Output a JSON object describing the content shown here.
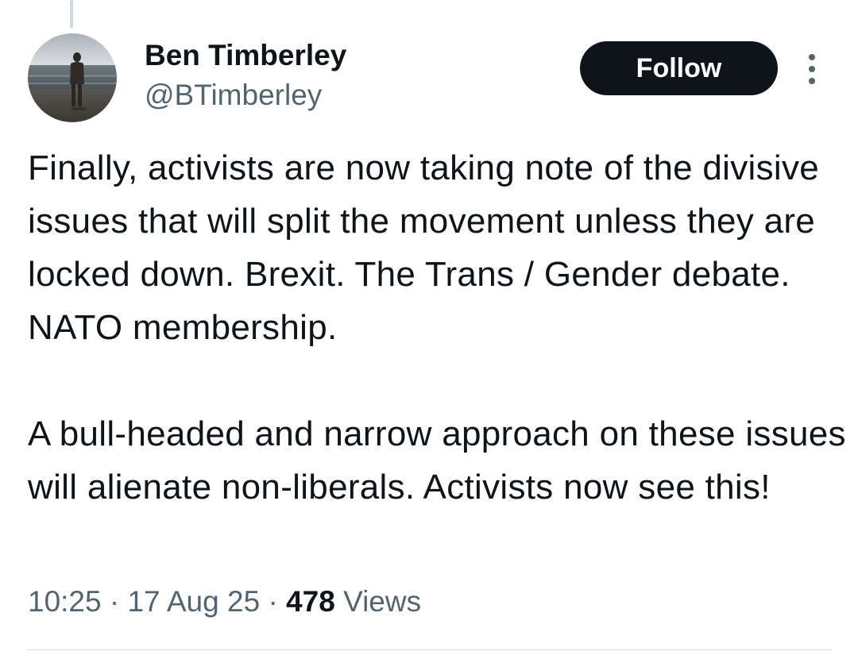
{
  "author": {
    "name": "Ben Timberley",
    "handle": "@BTimberley",
    "avatar_icon": "profile-photo-person-on-beach"
  },
  "actions": {
    "follow_label": "Follow",
    "more_icon": "vertical-ellipsis-icon"
  },
  "tweet": {
    "paragraphs": [
      "Finally, activists are now taking note of the divisive issues that will split the movement unless they are locked down. Brexit. The Trans / Gender debate. NATO membership.",
      "A bull-headed and narrow approach on these issues will alienate non-liberals. Activists now see this!"
    ]
  },
  "meta": {
    "time": "10:25",
    "separator": "·",
    "date": "17 Aug 25",
    "views_count": "478",
    "views_label": "Views"
  },
  "colors": {
    "text_primary": "#0f1419",
    "text_secondary": "#536471",
    "button_bg": "#0f1419",
    "divider": "#cfd9de"
  }
}
